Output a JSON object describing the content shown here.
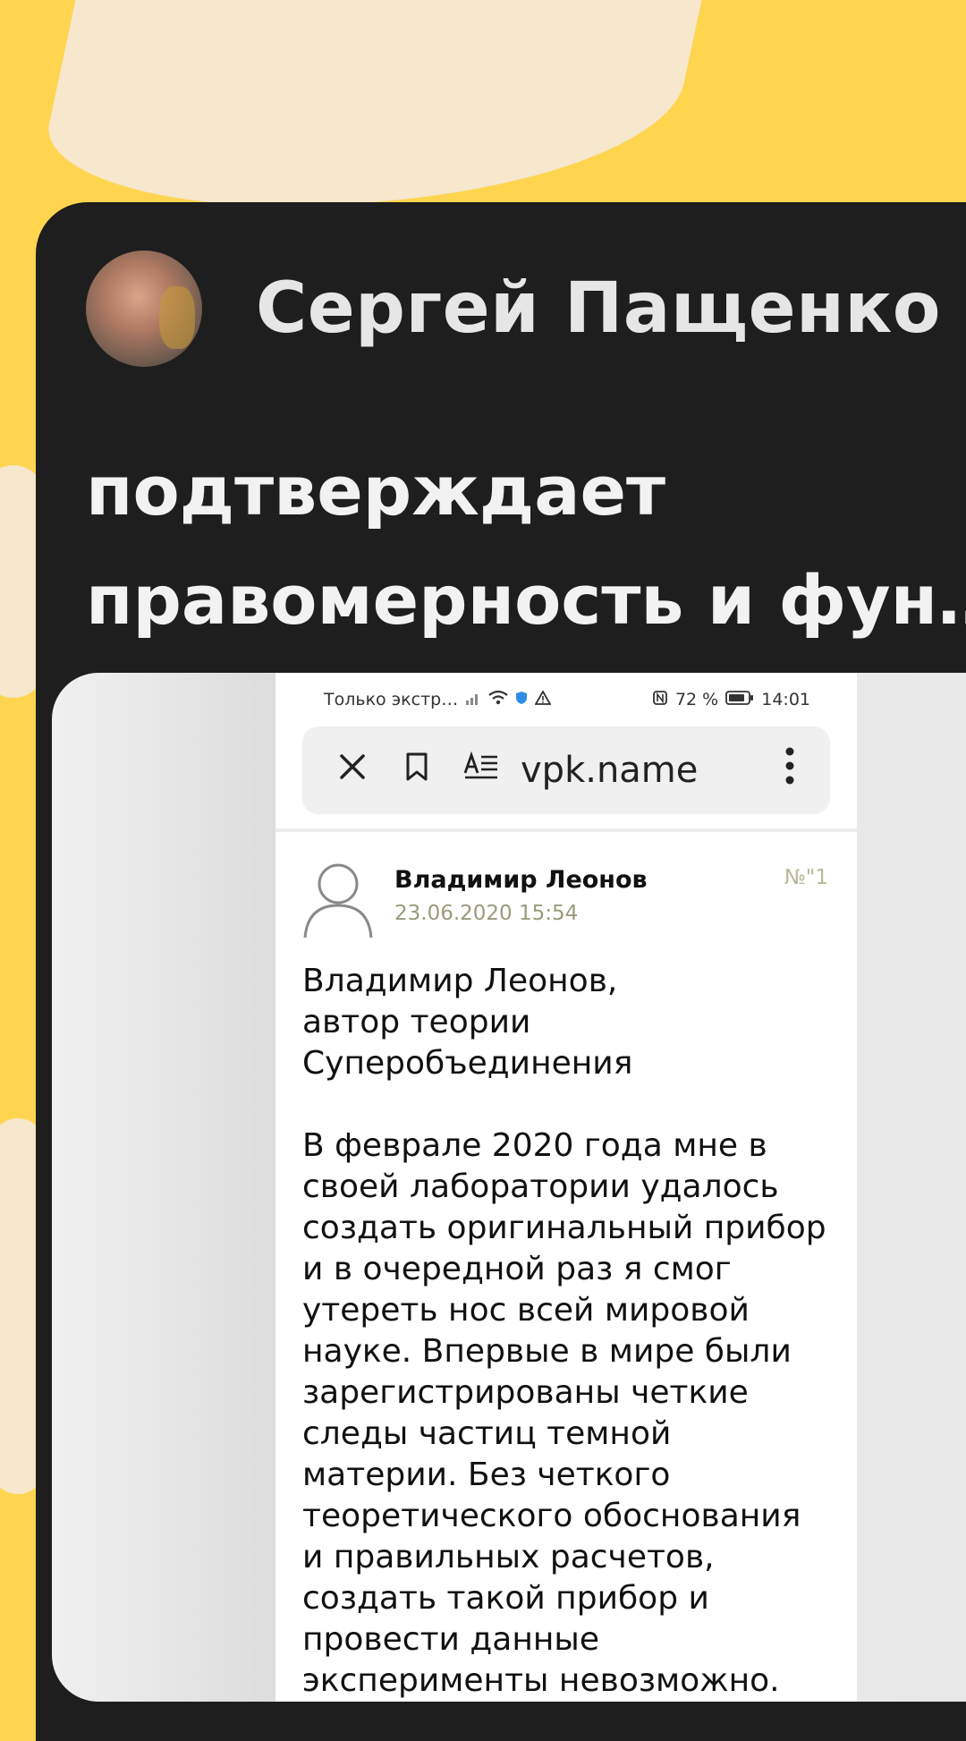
{
  "card": {
    "author": "Сергей Пащенко",
    "title_lines": [
      "подтверждает",
      "правомерность и фун…"
    ]
  },
  "screenshot": {
    "status_bar": {
      "carrier": "Только экстр…",
      "battery": "72 %",
      "time": "14:01"
    },
    "browser": {
      "url": "vpk.name"
    },
    "post": {
      "author": "Владимир Леонов",
      "date": "23.06.2020 15:54",
      "number": "№\"1",
      "intro": "Владимир Леонов,\nавтор теории\nСуперобъединения",
      "text": "В феврале 2020 года мне в своей лаборатории удалось создать оригинальный прибор и в очередной раз я смог утереть нос всей мировой науке. Впервые в мире были зарегистрированы четкие следы частиц темной материи. Без четкого теоретического обоснования и правильных расчетов, создать такой прибор и провести данные эксперименты невозможно. Этот эксперимент еще раз"
    }
  }
}
